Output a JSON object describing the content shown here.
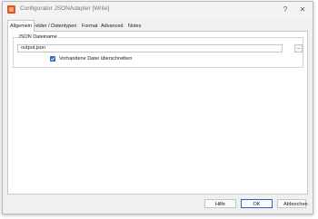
{
  "window": {
    "title": "Configurator JSONAdapter [Write]",
    "help_glyph": "?",
    "close_glyph": "✕"
  },
  "tabs": [
    {
      "label": "Allgemein",
      "active": true
    },
    {
      "label": "Felder / Datentypen",
      "active": false
    },
    {
      "label": "Format",
      "active": false
    },
    {
      "label": "Advanced",
      "active": false
    },
    {
      "label": "Notes",
      "active": false
    }
  ],
  "json_group": {
    "label": "JSON Dateiname",
    "file_value": "output.json",
    "browse_label": "...",
    "overwrite_label": "Vorhandene Datei überschreiben",
    "overwrite_checked": true
  },
  "footer": {
    "help_label": "Hilfe",
    "ok_label": "OK",
    "cancel_label": "Abbrechen"
  },
  "colors": {
    "accent": "#2a66c9",
    "app_icon": "#e2551d"
  }
}
